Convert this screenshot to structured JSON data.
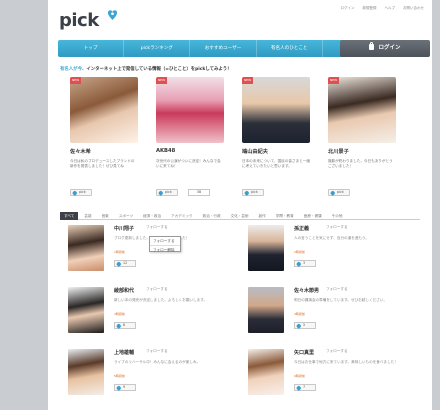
{
  "header": {
    "top_links": [
      "ログイン",
      "新規登録",
      "ヘルプ",
      "お問い合わせ"
    ],
    "logo": "pick",
    "nav": [
      "トップ",
      "pickランキング",
      "おすすめユーザー",
      "有名人のひとこと",
      "pickとは"
    ],
    "login_label": "ログイン"
  },
  "intro": {
    "highlight": "有名人が今、",
    "text": "インターネット上で発信している情報（=ひとこと）をpickしてみよう！"
  },
  "celebs": [
    {
      "tag": "NEW",
      "name": "佐々木希",
      "desc": "今日は私のプロデュースしたブランドの新作を発表しました！ぜひ見てね",
      "like": "pick",
      "count": ""
    },
    {
      "tag": "NEW",
      "name": "AKB48",
      "desc": "次世代の公演がついに決定！みんなで会いに来てね！",
      "like": "pick",
      "count": "38"
    },
    {
      "tag": "NEW",
      "name": "鳩山由紀夫",
      "desc": "日本の未来について、国民の皆さまと一緒に考えていきたいと思います。",
      "like": "pick",
      "count": ""
    },
    {
      "tag": "NEW",
      "name": "北川景子",
      "desc": "撮影が終わりました。今日もありがとうございました！",
      "like": "pick",
      "count": ""
    }
  ],
  "tabs": [
    "すべて",
    "芸能",
    "音楽",
    "スポーツ",
    "経済・政治",
    "アカデミック",
    "政治・行政",
    "文化・芸術",
    "創作",
    "学問・教育",
    "医療・健康",
    "その他"
  ],
  "entries": [
    {
      "name": "中川翔子",
      "follow": "フォローする",
      "desc": "ブログ更新しました。今日もいい一日でした！",
      "meta": "1時間前",
      "count": "12"
    },
    {
      "name": "孫正義",
      "follow": "フォローする",
      "desc": "人の言うことを気にせず、自分の道を進もう。",
      "meta": "2時間前",
      "count": "3"
    },
    {
      "name": "綾部和代",
      "follow": "フォローする",
      "desc": "新しい本の発売が決定しました。よろしくお願いします。",
      "meta": "3時間前",
      "count": "8"
    },
    {
      "name": "佐々木節男",
      "follow": "フォローする",
      "desc": "明日の講演会の準備をしています。ぜひお越しください。",
      "meta": "4時間前",
      "count": "5"
    },
    {
      "name": "上地雄輔",
      "follow": "フォローする",
      "desc": "ライブのリハーサル中！みんなに会えるのが楽しみ。",
      "meta": "5時間前",
      "count": "9"
    },
    {
      "name": "矢口真里",
      "follow": "フォローする",
      "desc": "今日はお仕事で地方に来ています。美味しいものを食べました！",
      "meta": "6時間前",
      "count": "7"
    }
  ],
  "popup": [
    "フォローする",
    "フォロー解除"
  ],
  "colors": {
    "accent": "#3ba6d3",
    "nav": "#35a3cc",
    "login": "#5a6068"
  }
}
